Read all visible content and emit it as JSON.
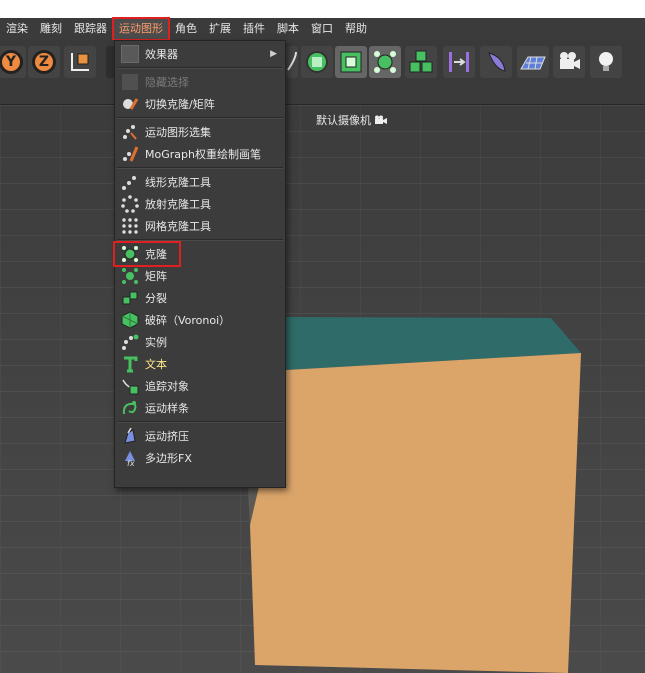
{
  "menubar": {
    "items": [
      "渲染",
      "雕刻",
      "跟踪器",
      "运动图形",
      "角色",
      "扩展",
      "插件",
      "脚本",
      "窗口",
      "帮助"
    ],
    "active": "运动图形"
  },
  "toolbar": {
    "axis_y": "Y",
    "axis_z": "Z"
  },
  "viewport": {
    "camera_label": "默认摄像机"
  },
  "dropdown": {
    "items": [
      {
        "label": "效果器",
        "icon": "folder-icon",
        "submenu": true
      },
      {
        "label": "隐藏选择",
        "icon": "hide-selection-icon",
        "disabled": true
      },
      {
        "label": "切换克隆/矩阵",
        "icon": "toggle-clone-matrix-icon"
      },
      {
        "label": "运动图形选集",
        "icon": "mograph-selection-icon"
      },
      {
        "label": "MoGraph权重绘制画笔",
        "icon": "weight-paint-brush-icon"
      },
      {
        "label": "线形克隆工具",
        "icon": "linear-clone-tool-icon"
      },
      {
        "label": "放射克隆工具",
        "icon": "radial-clone-tool-icon"
      },
      {
        "label": "网格克隆工具",
        "icon": "grid-clone-tool-icon"
      },
      {
        "label": "克隆",
        "icon": "cloner-icon",
        "boxed": true
      },
      {
        "label": "矩阵",
        "icon": "matrix-icon"
      },
      {
        "label": "分裂",
        "icon": "fracture-icon"
      },
      {
        "label": "破碎（Voronoi）",
        "icon": "voronoi-fracture-icon"
      },
      {
        "label": "实例",
        "icon": "instance-icon"
      },
      {
        "label": "文本",
        "icon": "text-icon",
        "highlight": true
      },
      {
        "label": "追踪对象",
        "icon": "tracer-icon"
      },
      {
        "label": "运动样条",
        "icon": "mospline-icon"
      },
      {
        "label": "运动挤压",
        "icon": "moextrude-icon"
      },
      {
        "label": "多边形FX",
        "icon": "polyfx-icon"
      }
    ]
  },
  "colors": {
    "cube_front": "#dba56a",
    "cube_top": "#2f6b68",
    "highlight_text": "#ffea8c",
    "red_box": "#e02020"
  }
}
